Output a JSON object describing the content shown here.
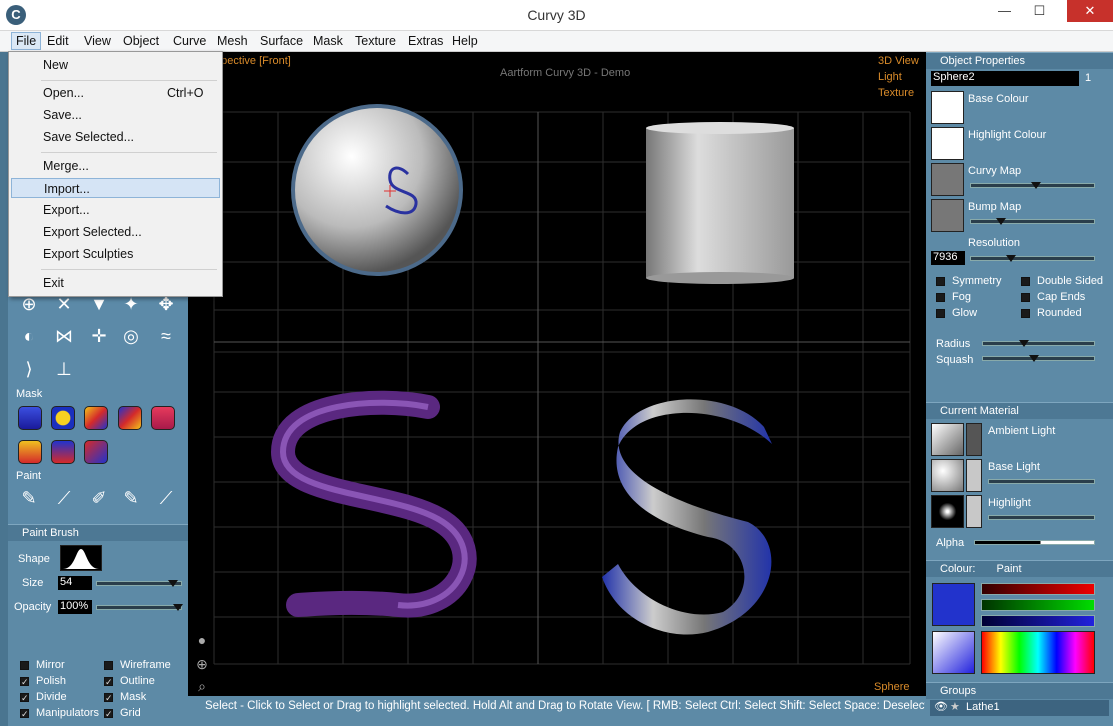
{
  "window": {
    "title": "Curvy 3D",
    "minimize": "—",
    "maximize": "☐",
    "close": "✕"
  },
  "menubar": [
    "File",
    "Edit",
    "View",
    "Object",
    "Curve",
    "Mesh",
    "Surface",
    "Mask",
    "Texture",
    "Extras",
    "Help"
  ],
  "file_menu": {
    "items": [
      {
        "label": "New",
        "shortcut": ""
      },
      {
        "label": "Open...",
        "shortcut": "Ctrl+O"
      },
      {
        "label": "Save...",
        "shortcut": ""
      },
      {
        "label": "Save Selected...",
        "shortcut": ""
      },
      {
        "label": "Merge...",
        "shortcut": ""
      },
      {
        "label": "Import...",
        "shortcut": ""
      },
      {
        "label": "Export...",
        "shortcut": ""
      },
      {
        "label": "Export Selected...",
        "shortcut": ""
      },
      {
        "label": "Export Sculpties",
        "shortcut": ""
      },
      {
        "label": "Exit",
        "shortcut": ""
      }
    ],
    "highlighted": "Import..."
  },
  "viewport": {
    "label": "rspective [Front]",
    "demo_title": "Aartform Curvy 3D - Demo",
    "modes": [
      "3D View",
      "Light",
      "Texture"
    ],
    "selected_object": "Sphere"
  },
  "left_panel": {
    "mask_label": "Mask",
    "paint_label": "Paint",
    "paint_brush": {
      "title": "Paint Brush",
      "shape_label": "Shape",
      "size_label": "Size",
      "size_value": "54",
      "size_level": 0.93,
      "opacity_label": "Opacity",
      "opacity_value": "100%",
      "opacity_level": 1.0
    },
    "options": [
      {
        "label": "Mirror",
        "checked": false
      },
      {
        "label": "Wireframe",
        "checked": false
      },
      {
        "label": "Polish",
        "checked": true
      },
      {
        "label": "Outline",
        "checked": true
      },
      {
        "label": "Divide",
        "checked": true
      },
      {
        "label": "Mask",
        "checked": true
      },
      {
        "label": "Manipulators",
        "checked": true
      },
      {
        "label": "Grid",
        "checked": true
      }
    ]
  },
  "object_properties": {
    "title": "Object Properties",
    "name": "Sphere2",
    "count": "1",
    "base_colour": "Base Colour",
    "highlight_colour": "Highlight Colour",
    "curvy_map": "Curvy Map",
    "curvy_map_level": 0.52,
    "bump_map": "Bump Map",
    "bump_map_level": 0.22,
    "resolution_label": "Resolution",
    "resolution_value": "7936",
    "resolution_level": 0.3,
    "flags": [
      {
        "label": "Symmetry",
        "checked": false
      },
      {
        "label": "Double Sided",
        "checked": false
      },
      {
        "label": "Fog",
        "checked": false
      },
      {
        "label": "Cap Ends",
        "checked": false
      },
      {
        "label": "Glow",
        "checked": false
      },
      {
        "label": "Rounded",
        "checked": false
      }
    ],
    "radius_label": "Radius",
    "radius_level": 0.35,
    "squash_label": "Squash",
    "squash_level": 0.45
  },
  "current_material": {
    "title": "Current Material",
    "ambient": "Ambient Light",
    "base": "Base Light",
    "highlight": "Highlight",
    "alpha": "Alpha",
    "alpha_level": 0.55
  },
  "colour_panel": {
    "title": "Colour:",
    "mode": "Paint",
    "current": "#2233cc",
    "red_level": 0.1,
    "green_level": 0.1,
    "blue_level": 0.8
  },
  "groups": {
    "title": "Groups",
    "item": "Lathe1"
  },
  "status": "Select - Click to Select or Drag to highlight selected. Hold Alt and Drag to Rotate View. [ RMB: Select   Ctrl: Select   Shift: Select   Space: Deselect"
}
